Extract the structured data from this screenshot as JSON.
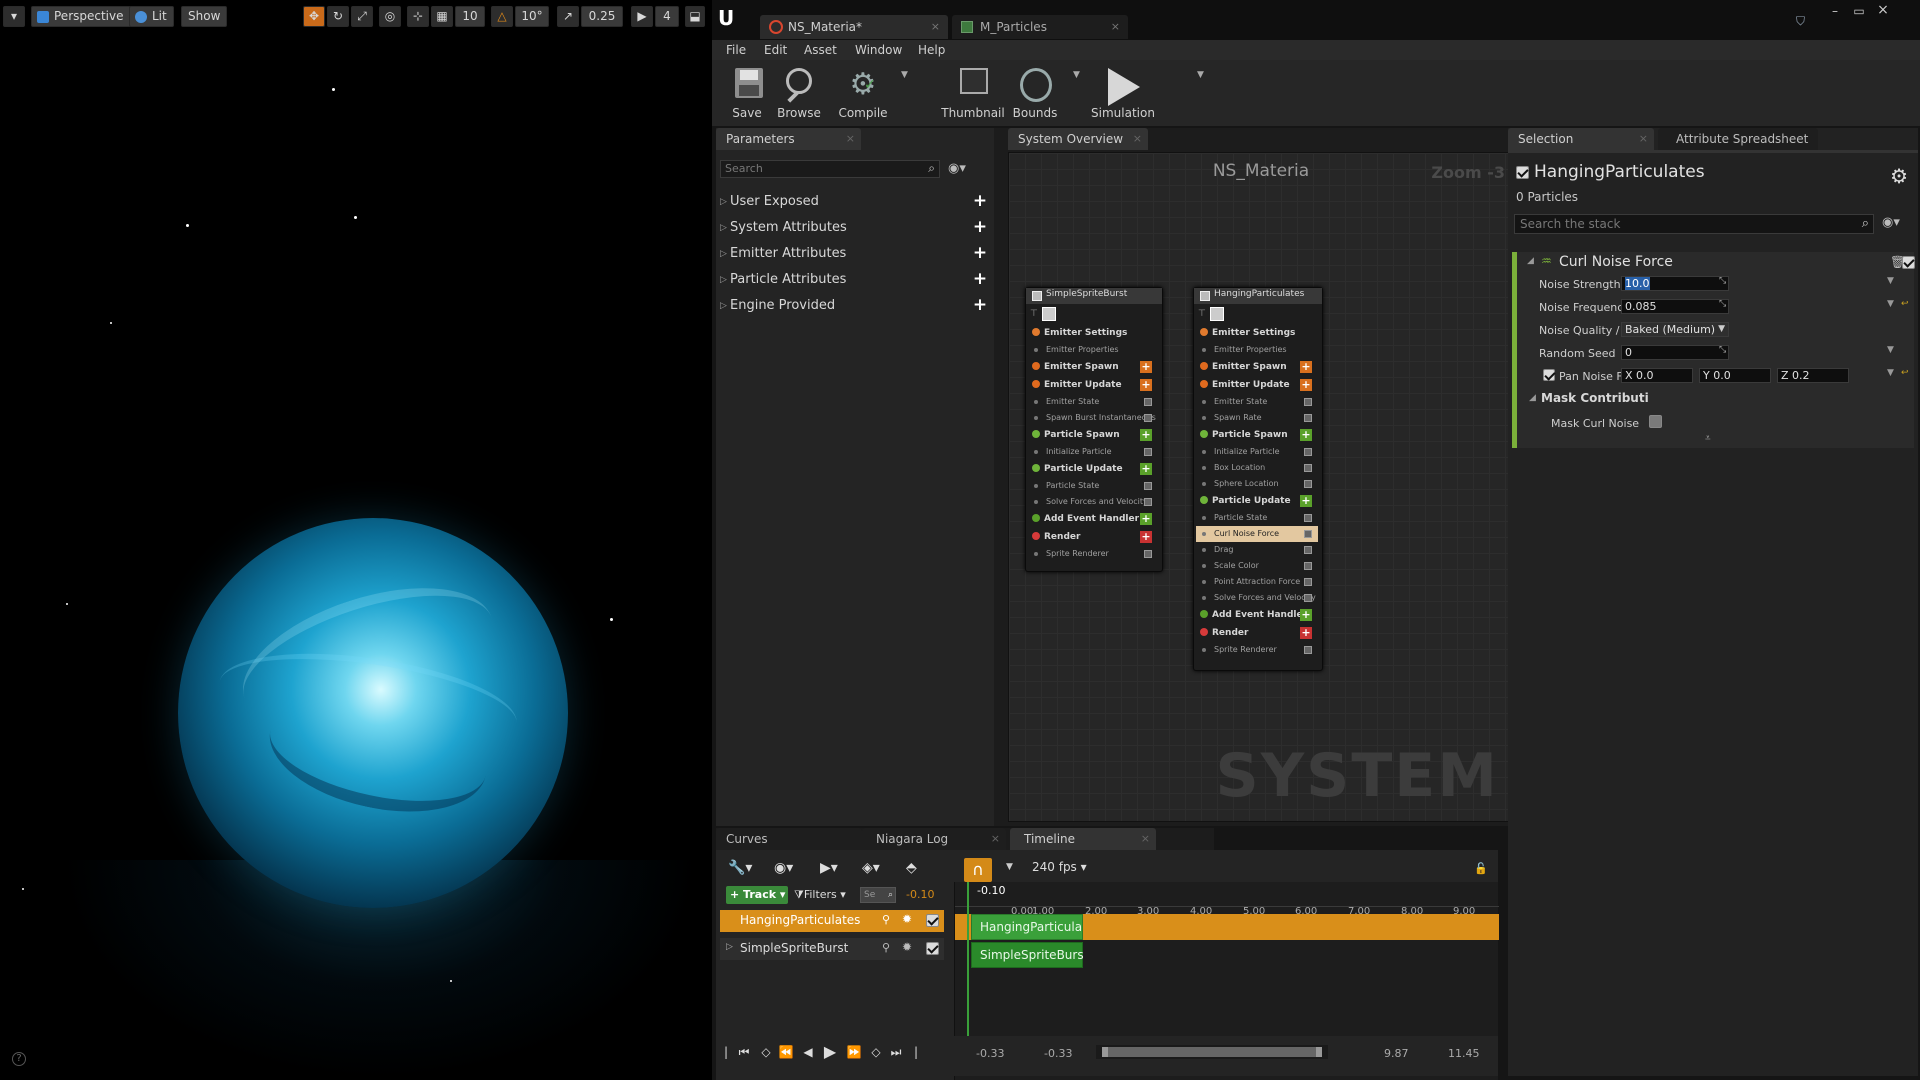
{
  "viewport": {
    "view_mode": "Perspective",
    "lighting": "Lit",
    "show": "Show",
    "grid_snap": "10",
    "rotation_snap": "10°",
    "scale_snap": "0.25",
    "camera_speed": "4"
  },
  "document_tabs": [
    {
      "label": "NS_Materia*"
    },
    {
      "label": "M_Particles"
    }
  ],
  "menu": [
    "File",
    "Edit",
    "Asset",
    "Window",
    "Help"
  ],
  "toolbar": {
    "save": "Save",
    "browse": "Browse",
    "compile": "Compile",
    "thumbnail": "Thumbnail",
    "bounds": "Bounds",
    "simulation": "Simulation"
  },
  "parameters": {
    "tab": "Parameters",
    "search_placeholder": "Search",
    "categories": [
      "User Exposed",
      "System Attributes",
      "Emitter Attributes",
      "Particle Attributes",
      "Engine Provided"
    ]
  },
  "system_overview": {
    "tab": "System Overview",
    "title": "NS_Materia",
    "zoom": "Zoom -3",
    "watermark": "SYSTEM",
    "emitters": [
      {
        "name": "SimpleSpriteBurst",
        "rows": [
          {
            "label": "Emitter Settings",
            "kind": "hdr",
            "color": "#e07a2e"
          },
          {
            "label": "Emitter Properties",
            "kind": "sub"
          },
          {
            "label": "Emitter Spawn",
            "kind": "hdr",
            "color": "#e06a1e",
            "plus": "#d9701e"
          },
          {
            "label": "Emitter Update",
            "kind": "hdr",
            "color": "#e06a1e",
            "plus": "#d9701e"
          },
          {
            "label": "Emitter State",
            "kind": "sub",
            "check": true
          },
          {
            "label": "Spawn Burst Instantaneous",
            "kind": "sub",
            "check": true
          },
          {
            "label": "Particle Spawn",
            "kind": "hdr",
            "color": "#6fb43a",
            "plus": "#5aa12a"
          },
          {
            "label": "Initialize Particle",
            "kind": "sub",
            "check": true
          },
          {
            "label": "Particle Update",
            "kind": "hdr",
            "color": "#6fb43a",
            "plus": "#5aa12a"
          },
          {
            "label": "Particle State",
            "kind": "sub",
            "check": true
          },
          {
            "label": "Solve Forces and Velocity",
            "kind": "sub",
            "check": true
          },
          {
            "label": "Add Event Handler",
            "kind": "hdr",
            "color": "#5aa12a",
            "plus": "#5aa12a"
          },
          {
            "label": "Render",
            "kind": "hdr",
            "color": "#d63a3a",
            "plus": "#c83232"
          },
          {
            "label": "Sprite Renderer",
            "kind": "sub",
            "check": true
          }
        ]
      },
      {
        "name": "HangingParticulates",
        "rows": [
          {
            "label": "Emitter Settings",
            "kind": "hdr",
            "color": "#e07a2e"
          },
          {
            "label": "Emitter Properties",
            "kind": "sub"
          },
          {
            "label": "Emitter Spawn",
            "kind": "hdr",
            "color": "#e06a1e",
            "plus": "#d9701e"
          },
          {
            "label": "Emitter Update",
            "kind": "hdr",
            "color": "#e06a1e",
            "plus": "#d9701e"
          },
          {
            "label": "Emitter State",
            "kind": "sub",
            "check": true
          },
          {
            "label": "Spawn Rate",
            "kind": "sub",
            "check": true
          },
          {
            "label": "Particle Spawn",
            "kind": "hdr",
            "color": "#6fb43a",
            "plus": "#5aa12a"
          },
          {
            "label": "Initialize Particle",
            "kind": "sub",
            "check": true
          },
          {
            "label": "Box Location",
            "kind": "sub",
            "check": true
          },
          {
            "label": "Sphere Location",
            "kind": "sub",
            "check": true
          },
          {
            "label": "Particle Update",
            "kind": "hdr",
            "color": "#6fb43a",
            "plus": "#5aa12a"
          },
          {
            "label": "Particle State",
            "kind": "sub",
            "check": true
          },
          {
            "label": "Curl Noise Force",
            "kind": "sub",
            "check": true,
            "selected": true
          },
          {
            "label": "Drag",
            "kind": "sub",
            "check": true
          },
          {
            "label": "Scale Color",
            "kind": "sub",
            "check": true
          },
          {
            "label": "Point Attraction Force",
            "kind": "sub",
            "check": true
          },
          {
            "label": "Solve Forces and Velocity",
            "kind": "sub",
            "check": true
          },
          {
            "label": "Add Event Handler",
            "kind": "hdr",
            "color": "#5aa12a",
            "plus": "#5aa12a"
          },
          {
            "label": "Render",
            "kind": "hdr",
            "color": "#d63a3a",
            "plus": "#c83232"
          },
          {
            "label": "Sprite Renderer",
            "kind": "sub",
            "check": true
          }
        ]
      }
    ]
  },
  "selection": {
    "tab": "Selection",
    "tab2": "Attribute Spreadsheet",
    "emitter_name": "HangingParticulates",
    "particles": "0 Particles",
    "search_placeholder": "Search the stack",
    "module_name": "Curl Noise Force",
    "props": [
      {
        "label": "Noise Strength",
        "value": "10.0"
      },
      {
        "label": "Noise Frequency",
        "value": "0.085"
      },
      {
        "label": "Noise Quality / Co",
        "value": "Baked (Medium)"
      },
      {
        "label": "Random Seed",
        "value": "0"
      }
    ],
    "pan_noise": {
      "label": "Pan Noise Fiel",
      "x": "X 0.0",
      "y": "Y 0.0",
      "z": "Z 0.2"
    },
    "mask_section": "Mask Contributi",
    "mask_label": "Mask Curl Noise"
  },
  "bottom_tabs": [
    "Curves",
    "Niagara Log",
    "Timeline"
  ],
  "timeline": {
    "fps": "240 fps",
    "track_button": "Track",
    "filters_button": "Filters",
    "search_placeholder": "Se",
    "current_time_small": "-0.10",
    "playhead_label": "-0.10",
    "ruler": [
      "0.00",
      "1.00",
      "2.00",
      "3.00",
      "4.00",
      "5.00",
      "6.00",
      "7.00",
      "8.00",
      "9.00"
    ],
    "tracks": [
      {
        "name": "HangingParticulates",
        "clip": "HangingParticula"
      },
      {
        "name": "SimpleSpriteBurst",
        "clip": "SimpleSpriteBurs"
      }
    ],
    "range": [
      "-0.33",
      "-0.33",
      "9.87",
      "11.45"
    ]
  }
}
